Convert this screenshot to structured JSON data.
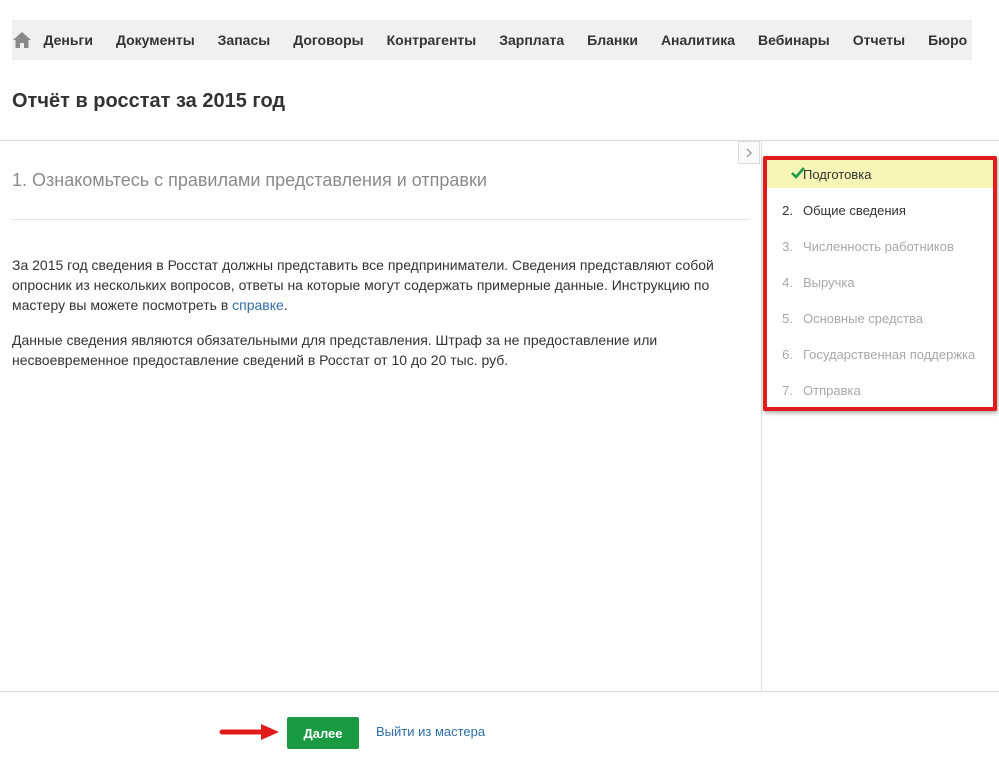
{
  "nav": {
    "home_icon": "home-icon",
    "items": [
      "Деньги",
      "Документы",
      "Запасы",
      "Договоры",
      "Контрагенты",
      "Зарплата",
      "Бланки",
      "Аналитика",
      "Вебинары",
      "Отчеты",
      "Бюро"
    ]
  },
  "page": {
    "title": "Отчёт в росстат за 2015 год"
  },
  "step": {
    "heading": "1. Ознакомьтесь с правилами представления и отправки",
    "p1_text": "За 2015 год сведения в Росстат должны представить все предприниматели. Сведения представляют собой опросник из нескольких вопросов, ответы на которые могут содержать примерные данные. Инструкцию по мастеру вы можете посмотреть в ",
    "p1_link": "справке",
    "p1_end": ".",
    "p2_text": "Данные сведения являются обязательными для представления. Штраф за не предоставление или несвоевременное предоставление сведений в Росстат от 10 до 20 тыс. руб."
  },
  "steps": [
    {
      "num": "",
      "label": "Подготовка",
      "state": "active"
    },
    {
      "num": "2.",
      "label": "Общие сведения",
      "state": "enabled"
    },
    {
      "num": "3.",
      "label": "Численность работников",
      "state": "disabled"
    },
    {
      "num": "4.",
      "label": "Выручка",
      "state": "disabled"
    },
    {
      "num": "5.",
      "label": "Основные средства",
      "state": "disabled"
    },
    {
      "num": "6.",
      "label": "Государственная поддержка",
      "state": "disabled"
    },
    {
      "num": "7.",
      "label": "Отправка",
      "state": "disabled"
    }
  ],
  "footer": {
    "next_label": "Далее",
    "exit_label": "Выйти из мастера"
  },
  "colors": {
    "accent_green": "#1a9a43",
    "link_blue": "#2f6ea8",
    "highlight_red": "#e01b1b",
    "active_step_bg": "#f6f5b6"
  }
}
